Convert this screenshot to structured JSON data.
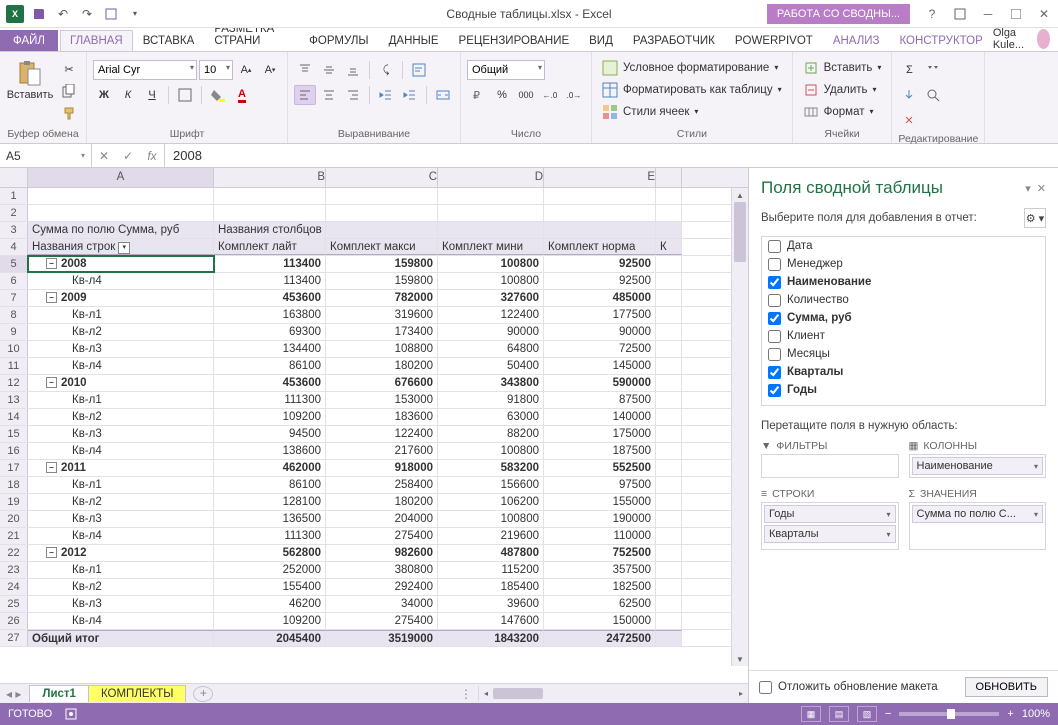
{
  "titlebar": {
    "title": "Сводные таблицы.xlsx - Excel",
    "context": "РАБОТА СО СВОДНЫ..."
  },
  "ribbon": {
    "file": "ФАЙЛ",
    "tabs": [
      "ГЛАВНАЯ",
      "ВСТАВКА",
      "РАЗМЕТКА СТРАНИ",
      "ФОРМУЛЫ",
      "ДАННЫЕ",
      "РЕЦЕНЗИРОВАНИЕ",
      "ВИД",
      "РАЗРАБОТЧИК",
      "POWERPIVOT"
    ],
    "ctx_tabs": [
      "АНАЛИЗ",
      "КОНСТРУКТОР"
    ],
    "user": "Olga Kule...",
    "groups": {
      "clipboard": {
        "label": "Буфер обмена",
        "paste": "Вставить"
      },
      "font": {
        "label": "Шрифт",
        "name": "Arial Cyr",
        "size": "10"
      },
      "align": {
        "label": "Выравнивание"
      },
      "number": {
        "label": "Число",
        "format": "Общий"
      },
      "styles": {
        "label": "Стили",
        "cond": "Условное форматирование",
        "table": "Форматировать как таблицу",
        "cell": "Стили ячеек"
      },
      "cells": {
        "label": "Ячейки",
        "insert": "Вставить",
        "delete": "Удалить",
        "format": "Формат"
      },
      "editing": {
        "label": "Редактирование"
      }
    }
  },
  "formula": {
    "name_box": "A5",
    "value": "2008"
  },
  "grid": {
    "cols": [
      "A",
      "B",
      "C",
      "D",
      "E"
    ],
    "rownums": [
      1,
      2,
      3,
      4,
      5,
      6,
      7,
      8,
      9,
      10,
      11,
      12,
      13,
      14,
      15,
      16,
      17,
      18,
      19,
      20,
      21,
      22,
      23,
      24,
      25,
      26,
      27
    ],
    "r3a": "Сумма по полю Сумма, руб",
    "r3b": "Названия столбцов",
    "r4a": "Названия строк",
    "r4b": "Комплект лайт",
    "r4c": "Комплект макси",
    "r4d": "Комплект мини",
    "r4e": "Комплект норма",
    "r4f": "К",
    "data": [
      {
        "a": "2008",
        "b": "113400",
        "c": "159800",
        "d": "100800",
        "e": "92500",
        "bold": true,
        "exp": true
      },
      {
        "a": "Кв-л4",
        "b": "113400",
        "c": "159800",
        "d": "100800",
        "e": "92500",
        "ind": 2
      },
      {
        "a": "2009",
        "b": "453600",
        "c": "782000",
        "d": "327600",
        "e": "485000",
        "bold": true,
        "exp": true
      },
      {
        "a": "Кв-л1",
        "b": "163800",
        "c": "319600",
        "d": "122400",
        "e": "177500",
        "ind": 2
      },
      {
        "a": "Кв-л2",
        "b": "69300",
        "c": "173400",
        "d": "90000",
        "e": "90000",
        "ind": 2
      },
      {
        "a": "Кв-л3",
        "b": "134400",
        "c": "108800",
        "d": "64800",
        "e": "72500",
        "ind": 2
      },
      {
        "a": "Кв-л4",
        "b": "86100",
        "c": "180200",
        "d": "50400",
        "e": "145000",
        "ind": 2
      },
      {
        "a": "2010",
        "b": "453600",
        "c": "676600",
        "d": "343800",
        "e": "590000",
        "bold": true,
        "exp": true
      },
      {
        "a": "Кв-л1",
        "b": "111300",
        "c": "153000",
        "d": "91800",
        "e": "87500",
        "ind": 2
      },
      {
        "a": "Кв-л2",
        "b": "109200",
        "c": "183600",
        "d": "63000",
        "e": "140000",
        "ind": 2
      },
      {
        "a": "Кв-л3",
        "b": "94500",
        "c": "122400",
        "d": "88200",
        "e": "175000",
        "ind": 2
      },
      {
        "a": "Кв-л4",
        "b": "138600",
        "c": "217600",
        "d": "100800",
        "e": "187500",
        "ind": 2
      },
      {
        "a": "2011",
        "b": "462000",
        "c": "918000",
        "d": "583200",
        "e": "552500",
        "bold": true,
        "exp": true
      },
      {
        "a": "Кв-л1",
        "b": "86100",
        "c": "258400",
        "d": "156600",
        "e": "97500",
        "ind": 2
      },
      {
        "a": "Кв-л2",
        "b": "128100",
        "c": "180200",
        "d": "106200",
        "e": "155000",
        "ind": 2
      },
      {
        "a": "Кв-л3",
        "b": "136500",
        "c": "204000",
        "d": "100800",
        "e": "190000",
        "ind": 2
      },
      {
        "a": "Кв-л4",
        "b": "111300",
        "c": "275400",
        "d": "219600",
        "e": "110000",
        "ind": 2
      },
      {
        "a": "2012",
        "b": "562800",
        "c": "982600",
        "d": "487800",
        "e": "752500",
        "bold": true,
        "exp": true
      },
      {
        "a": "Кв-л1",
        "b": "252000",
        "c": "380800",
        "d": "115200",
        "e": "357500",
        "ind": 2
      },
      {
        "a": "Кв-л2",
        "b": "155400",
        "c": "292400",
        "d": "185400",
        "e": "182500",
        "ind": 2
      },
      {
        "a": "Кв-л3",
        "b": "46200",
        "c": "34000",
        "d": "39600",
        "e": "62500",
        "ind": 2
      },
      {
        "a": "Кв-л4",
        "b": "109200",
        "c": "275400",
        "d": "147600",
        "e": "150000",
        "ind": 2
      },
      {
        "a": "Общий итог",
        "b": "2045400",
        "c": "3519000",
        "d": "1843200",
        "e": "2472500",
        "bold": true,
        "grand": true
      }
    ]
  },
  "sheets": {
    "nav": "",
    "tabs": [
      "Лист1",
      "КОМПЛЕКТЫ"
    ]
  },
  "taskpane": {
    "title": "Поля сводной таблицы",
    "sub": "Выберите поля для добавления в отчет:",
    "fields": [
      {
        "name": "Дата",
        "checked": false
      },
      {
        "name": "Менеджер",
        "checked": false
      },
      {
        "name": "Наименование",
        "checked": true
      },
      {
        "name": "Количество",
        "checked": false
      },
      {
        "name": "Сумма, руб",
        "checked": true
      },
      {
        "name": "Клиент",
        "checked": false
      },
      {
        "name": "Месяцы",
        "checked": false
      },
      {
        "name": "Кварталы",
        "checked": true
      },
      {
        "name": "Годы",
        "checked": true
      }
    ],
    "drag_lbl": "Перетащите поля в нужную область:",
    "zones": {
      "filters": {
        "hdr": "ФИЛЬТРЫ",
        "items": []
      },
      "cols": {
        "hdr": "КОЛОННЫ",
        "items": [
          "Наименование"
        ]
      },
      "rows": {
        "hdr": "СТРОКИ",
        "items": [
          "Годы",
          "Кварталы"
        ]
      },
      "vals": {
        "hdr": "ЗНАЧЕНИЯ",
        "items": [
          "Сумма по полю С..."
        ]
      }
    },
    "defer": "Отложить обновление макета",
    "update": "ОБНОВИТЬ"
  },
  "status": {
    "ready": "ГОТОВО",
    "zoom": "100%"
  }
}
